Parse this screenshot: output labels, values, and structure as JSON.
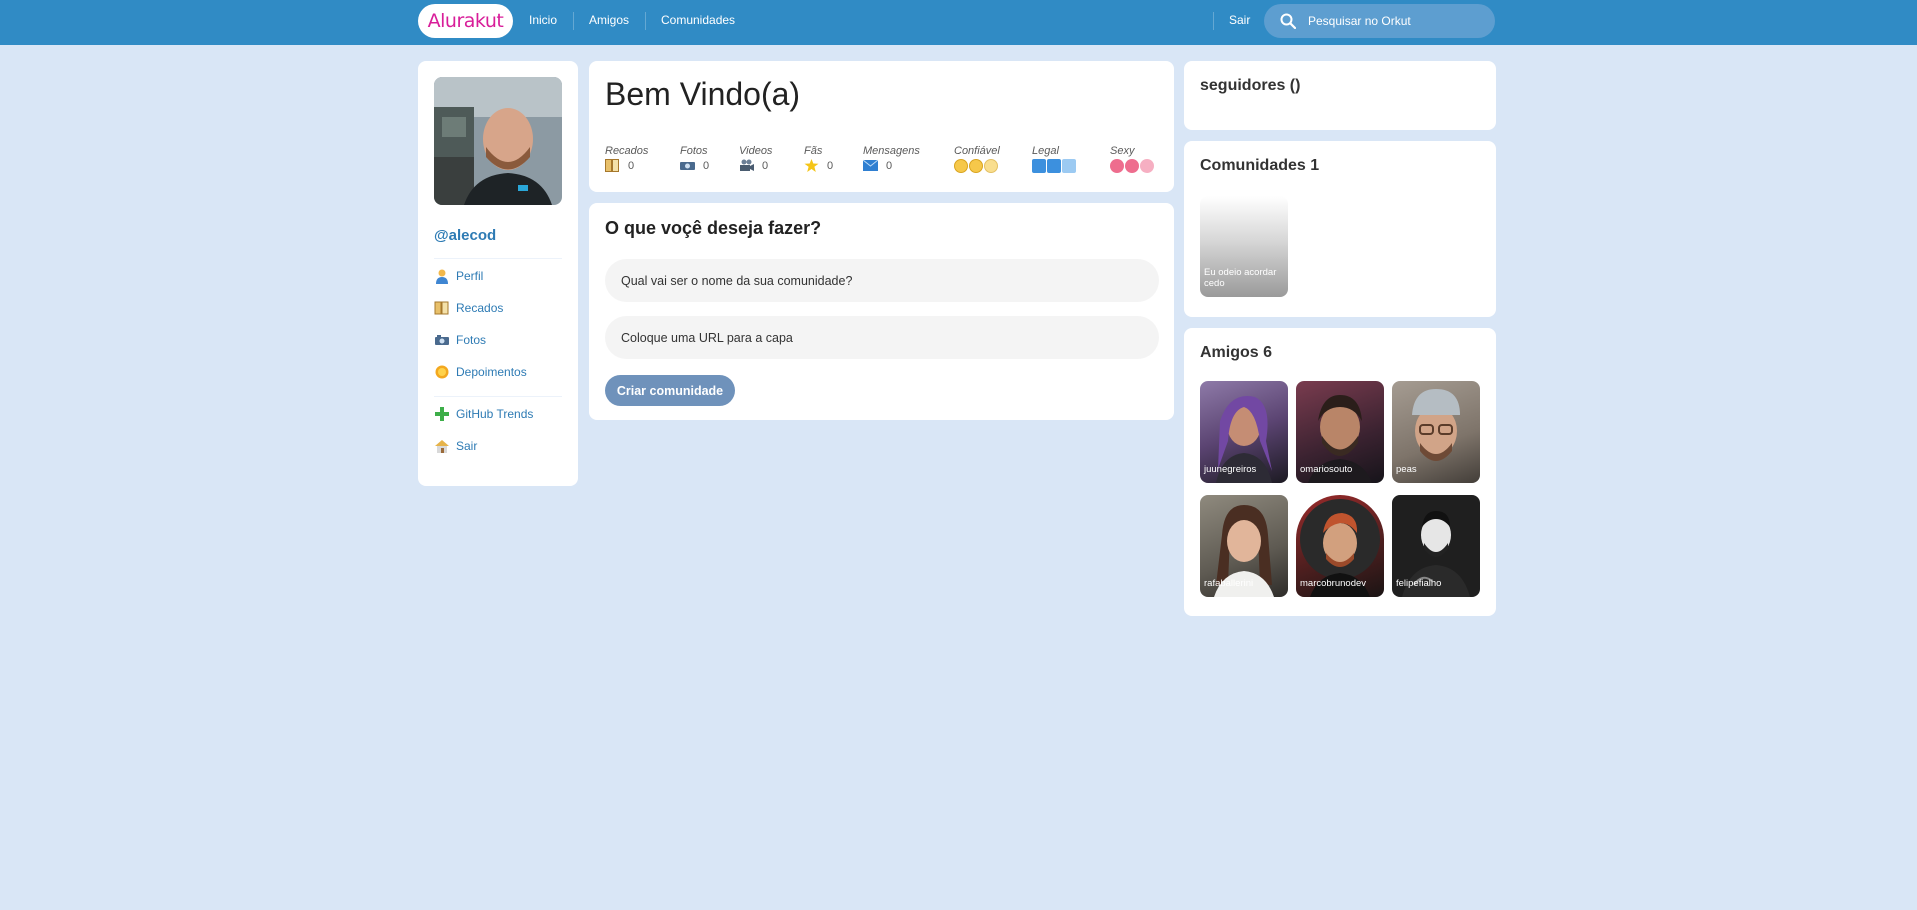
{
  "header": {
    "logo": "Alurakut",
    "nav": [
      "Inicio",
      "Amigos",
      "Comunidades"
    ],
    "logout": "Sair",
    "search_placeholder": "Pesquisar no Orkut"
  },
  "profile": {
    "username": "@alecod",
    "menu": [
      {
        "label": "Perfil",
        "icon": "user-icon"
      },
      {
        "label": "Recados",
        "icon": "notes-icon"
      },
      {
        "label": "Fotos",
        "icon": "camera-icon"
      },
      {
        "label": "Depoimentos",
        "icon": "sun-icon"
      }
    ],
    "menu2": [
      {
        "label": "GitHub Trends",
        "icon": "plus-icon"
      },
      {
        "label": "Sair",
        "icon": "home-icon"
      }
    ]
  },
  "welcome": {
    "title": "Bem Vindo(a)",
    "stats": [
      {
        "label": "Recados",
        "value": "0",
        "icon": "notes-icon"
      },
      {
        "label": "Fotos",
        "value": "0",
        "icon": "camera-icon"
      },
      {
        "label": "Videos",
        "value": "0",
        "icon": "video-camera-icon"
      },
      {
        "label": "Fãs",
        "value": "0",
        "icon": "star-icon"
      },
      {
        "label": "Mensagens",
        "value": "0",
        "icon": "envelope-icon"
      }
    ],
    "ratings": [
      {
        "label": "Confiável",
        "icon": "smiley-icon"
      },
      {
        "label": "Legal",
        "icon": "ice-cube-icon"
      },
      {
        "label": "Sexy",
        "icon": "heart-icon"
      }
    ]
  },
  "form": {
    "title": "O que voçê deseja fazer?",
    "name_placeholder": "Qual vai ser o nome da sua comunidade?",
    "url_placeholder": "Coloque uma URL para a capa",
    "submit": "Criar comunidade"
  },
  "followers": {
    "title": "seguidores ()"
  },
  "communities": {
    "title": "Comunidades 1",
    "items": [
      "Eu odeio acordar cedo"
    ]
  },
  "friends": {
    "title": "Amigos 6",
    "items": [
      "juunegreiros",
      "omariosouto",
      "peas",
      "rafaballerini",
      "marcobrunodev",
      "felipefialho"
    ]
  },
  "colors": {
    "topbar": "#308BC5",
    "background": "#D9E6F6",
    "link": "#2E7BB4",
    "logo": "#D81D99",
    "button": "#6F92BB"
  }
}
